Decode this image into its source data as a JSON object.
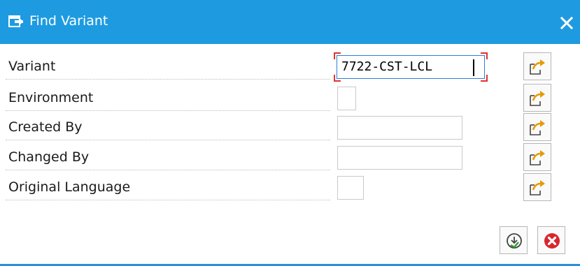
{
  "window": {
    "title": "Find Variant",
    "icon": "find-dialog-icon",
    "close_icon": "close-icon",
    "title_bar_color": "#1e9be0"
  },
  "fields": [
    {
      "label": "Variant",
      "value": "7722-CST-LCL",
      "focused": true
    },
    {
      "label": "Environment",
      "value": ""
    },
    {
      "label": "Created By",
      "value": ""
    },
    {
      "label": "Changed By",
      "value": ""
    },
    {
      "label": "Original Language",
      "value": ""
    }
  ],
  "multiple_selection_icon": "multiple-selection-icon",
  "footer": {
    "execute_icon": "execute-icon",
    "cancel_icon": "cancel-icon"
  }
}
